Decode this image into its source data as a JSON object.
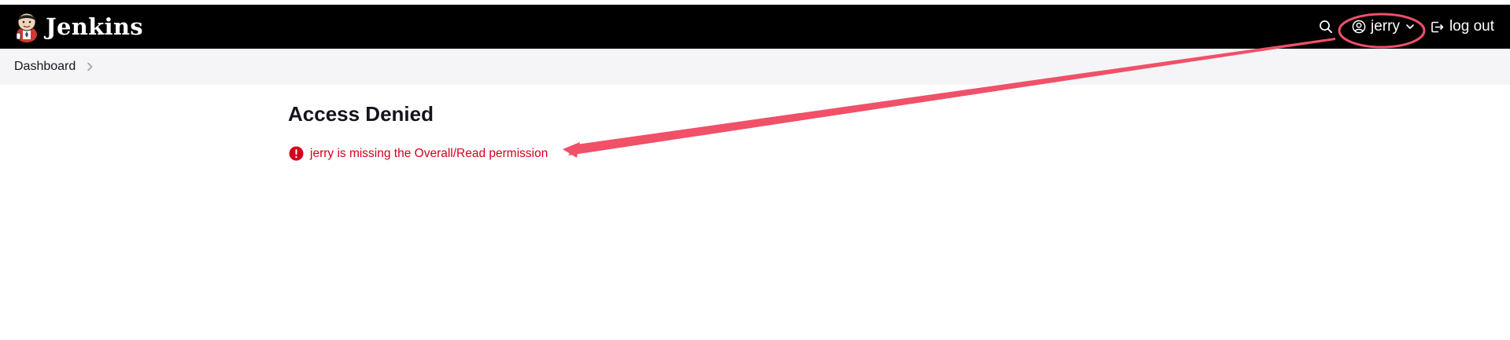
{
  "colors": {
    "header_bg": "#000000",
    "header_text": "#ffffff",
    "breadcrumb_bg": "#f5f5f7",
    "error": "#d5011d",
    "annotation": "#f05068"
  },
  "header": {
    "app_name": "Jenkins",
    "logo_icon": "jenkins-butler-logo",
    "search_icon": "search-icon",
    "user": {
      "name": "jerry",
      "icon": "user-circle-icon",
      "dropdown_icon": "chevron-down-icon"
    },
    "logout": {
      "label": "log out",
      "icon": "logout-icon"
    }
  },
  "breadcrumb": {
    "items": [
      {
        "label": "Dashboard"
      }
    ],
    "separator_icon": "chevron-right-icon"
  },
  "main": {
    "title": "Access Denied",
    "error": {
      "icon": "error-exclamation-icon",
      "message": "jerry is missing the Overall/Read permission"
    }
  },
  "annotation": {
    "highlight": "ellipse around user menu",
    "arrow": "arrow from user menu to error message"
  }
}
